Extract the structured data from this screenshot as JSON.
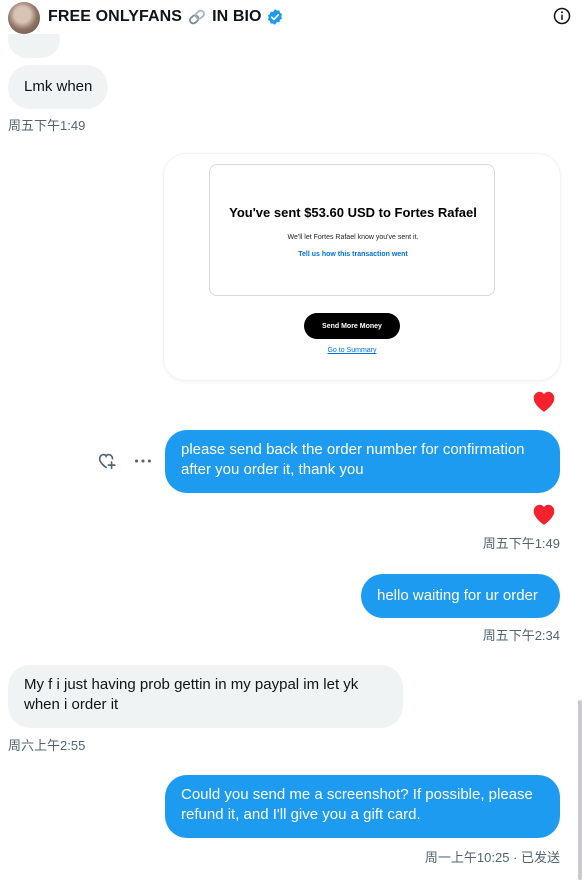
{
  "header": {
    "name_part1": "FREE ONLYFANS",
    "name_part2": "IN BIO"
  },
  "messages": [
    {
      "text": "Lmk when",
      "time": "周五下午1:49"
    },
    {
      "payment_card": {
        "title": "You've sent $53.60 USD to Fortes Rafael",
        "subtitle": "We'll let Fortes Rafael know you've sent it.",
        "link": "Tell us how this transaction went",
        "button": "Send More Money",
        "summary_link": "Go to Summary"
      }
    },
    {
      "text": "please send back the order number for confirmation after you order it, thank you",
      "time": "周五下午1:49"
    },
    {
      "text": "hello waiting for ur order",
      "time": "周五下午2:34"
    },
    {
      "text": "My f i just having prob gettin in my paypal im let yk when i order it",
      "time": "周六上午2:55"
    },
    {
      "text": "Could you send me a screenshot? If possible, please refund it, and I'll give you a gift card.",
      "time": "周一上午10:25 · 已发送"
    }
  ],
  "colors": {
    "outgoing_bubble": "#1d9bf0",
    "incoming_bubble": "#eff3f4",
    "heart": "#f4212e",
    "verified": "#1d9bf0"
  },
  "icons": [
    "link-icon",
    "verified-badge-icon",
    "info-icon",
    "heart-reaction-icon",
    "add-reaction-icon",
    "more-options-icon"
  ]
}
